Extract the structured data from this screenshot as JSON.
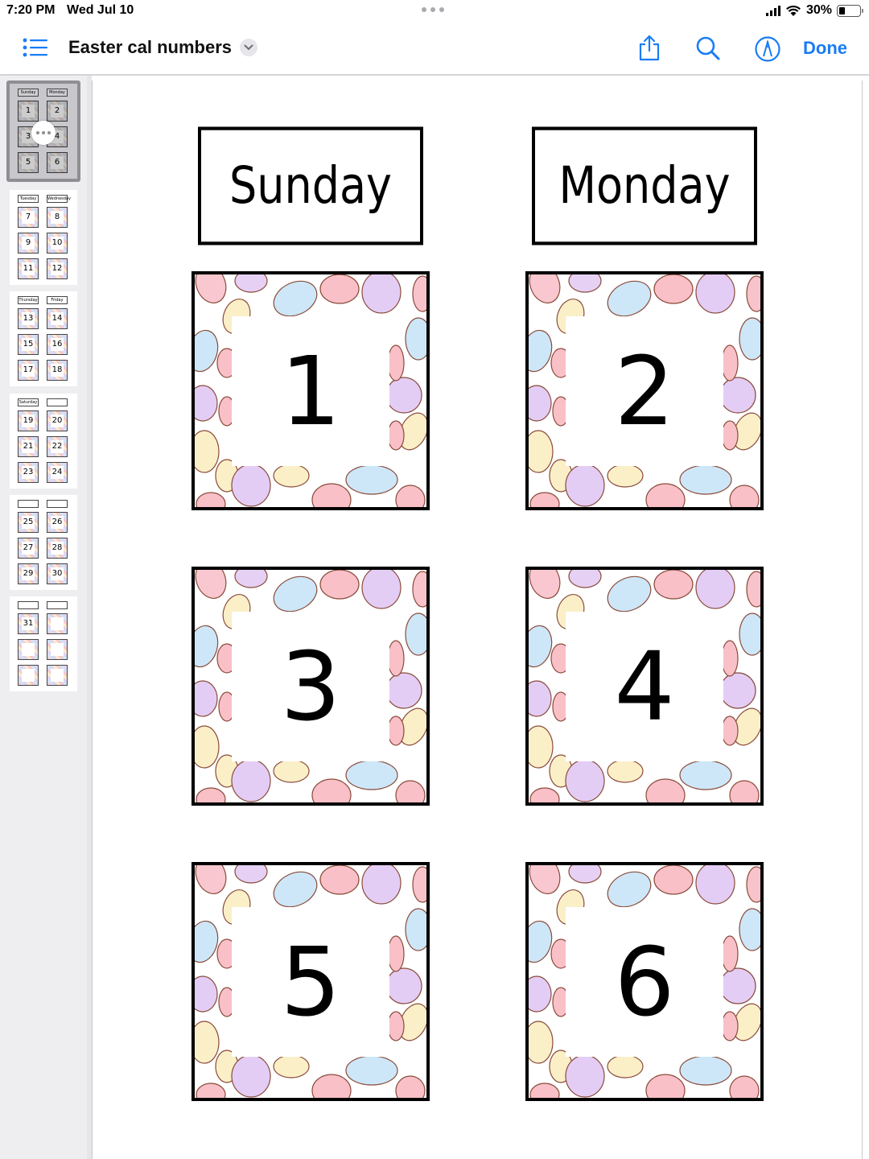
{
  "status_bar": {
    "time": "7:20 PM",
    "date": "Wed Jul 10",
    "battery": "30%",
    "battery_level": 0.3,
    "icons": [
      "signal-icon",
      "wifi-icon",
      "battery-icon"
    ]
  },
  "toolbar": {
    "title": "Easter cal numbers",
    "done_label": "Done",
    "accent_color": "#1a7cf5",
    "icons": [
      "list-icon",
      "chevron-down-icon",
      "share-icon",
      "search-icon",
      "markup-icon"
    ]
  },
  "sidebar": {
    "pages": [
      {
        "headers": [
          "Sunday",
          "Monday"
        ],
        "numbers": [
          "1",
          "2",
          "3",
          "4",
          "5",
          "6"
        ],
        "selected": true
      },
      {
        "headers": [
          "Tuesday",
          "Wednesday"
        ],
        "numbers": [
          "7",
          "8",
          "9",
          "10",
          "11",
          "12"
        ]
      },
      {
        "headers": [
          "Thursday",
          "Friday"
        ],
        "numbers": [
          "13",
          "14",
          "15",
          "16",
          "17",
          "18"
        ]
      },
      {
        "headers": [
          "Saturday",
          ""
        ],
        "numbers": [
          "19",
          "20",
          "21",
          "22",
          "23",
          "24"
        ]
      },
      {
        "headers": [
          "",
          ""
        ],
        "numbers": [
          "25",
          "26",
          "27",
          "28",
          "29",
          "30"
        ]
      },
      {
        "headers": [
          "",
          ""
        ],
        "numbers": [
          "31",
          "",
          "",
          "",
          "",
          ""
        ]
      }
    ]
  },
  "document": {
    "day_labels": [
      "Sunday",
      "Monday"
    ],
    "numbers": [
      "1",
      "2",
      "3",
      "4",
      "5",
      "6"
    ]
  }
}
